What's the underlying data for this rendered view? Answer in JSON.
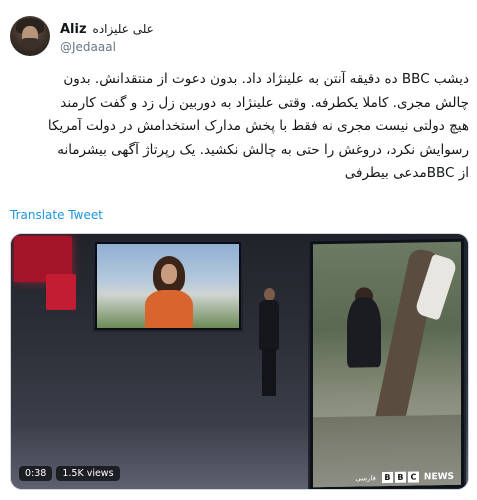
{
  "author": {
    "name": "Aliz",
    "name_fa": "علی علیزاده",
    "handle": "@Jedaaal"
  },
  "tweet": {
    "lines": [
      "دیشب BBC ده دقیقه آنتن به علینژاد داد. بدون دعوت از منتقدانش. بدون",
      "چالش مجری. کاملا یکطرفه. وقتی علینژاد به دوربین زل زد و گفت کارمند",
      "هیچ دولتی نیست مجری نه فقط با پخش مدارک استخدامش در دولت آمریکا",
      "رسوایش نکرد، دروغش را حتی به چالش نکشید. یک رپرتاژ آگهی بیشرمانه",
      "از BBCمدعی بیطرفی"
    ],
    "translate_label": "Translate Tweet"
  },
  "media": {
    "duration": "0:38",
    "views": "1.5K views",
    "channel_logo": {
      "blocks": [
        "B",
        "B",
        "C"
      ],
      "label": "NEWS",
      "lang": "فارسی"
    }
  }
}
